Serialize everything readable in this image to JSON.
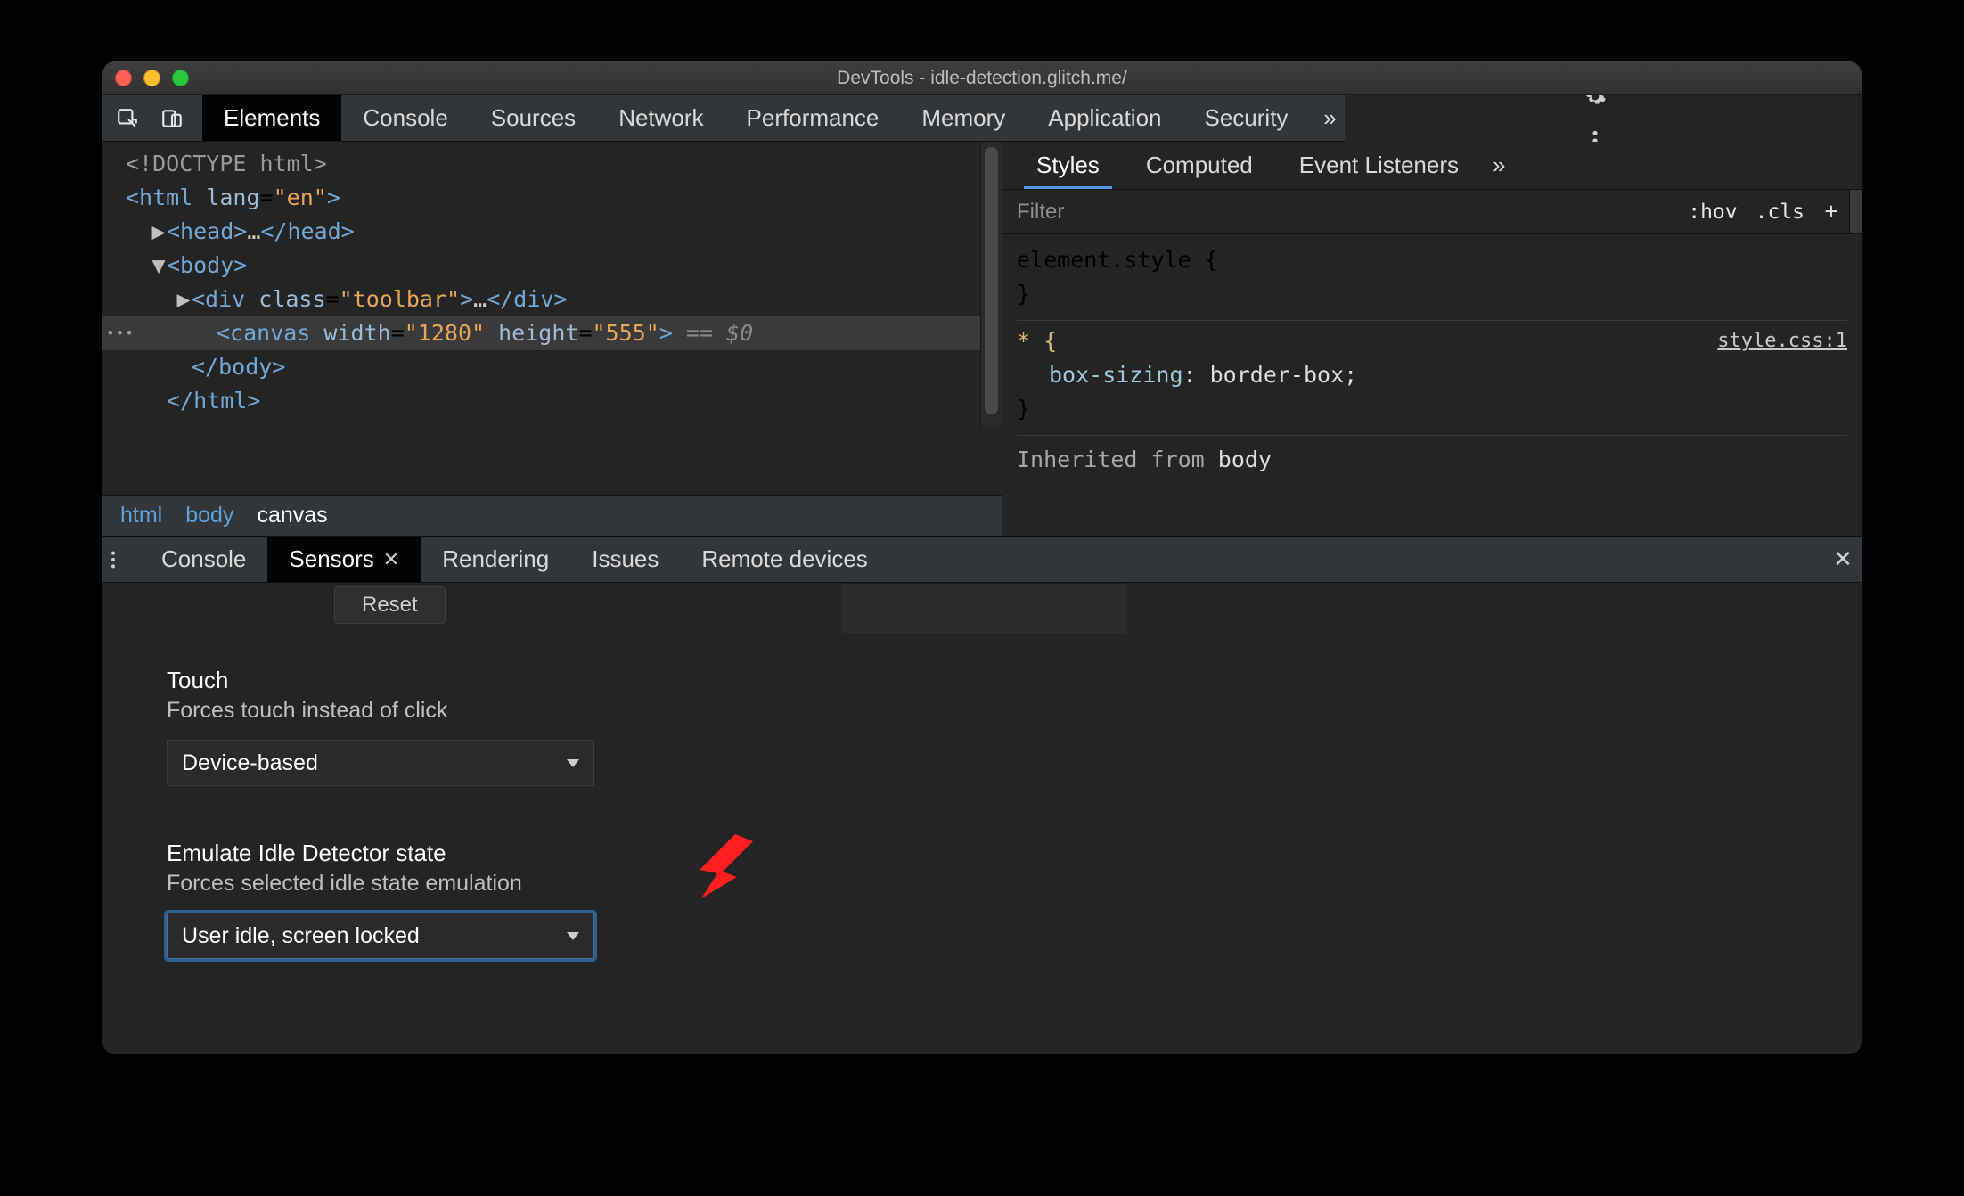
{
  "window": {
    "title": "DevTools - idle-detection.glitch.me/"
  },
  "tabs": {
    "items": [
      "Elements",
      "Console",
      "Sources",
      "Network",
      "Performance",
      "Memory",
      "Application",
      "Security"
    ],
    "active": "Elements"
  },
  "dom_tree": {
    "lines": [
      {
        "indent": 0,
        "html": "<span class='c-doctype'>&lt;!DOCTYPE html&gt;</span>",
        "selected": false
      },
      {
        "indent": 0,
        "html": "<span class='c-tag'>&lt;html</span> <span class='c-attr'>lang</span>=<span class='c-val'>\"en\"</span><span class='c-tag'>&gt;</span>",
        "selected": false
      },
      {
        "indent": 1,
        "caret": "▶",
        "html": "<span class='c-tag'>&lt;head&gt;</span><span class='c-text'>…</span><span class='c-tag'>&lt;/head&gt;</span>",
        "selected": false
      },
      {
        "indent": 1,
        "caret": "▼",
        "html": "<span class='c-tag'>&lt;body&gt;</span>",
        "selected": false
      },
      {
        "indent": 2,
        "caret": "▶",
        "html": "<span class='c-tag'>&lt;div</span> <span class='c-attr'>class</span>=<span class='c-val'>\"toolbar\"</span><span class='c-tag'>&gt;</span><span class='c-text'>…</span><span class='c-tag'>&lt;/div&gt;</span>",
        "selected": false
      },
      {
        "indent": 3,
        "html": "<span class='c-tag'>&lt;canvas</span> <span class='c-attr'>width</span>=<span class='c-val'>\"1280\"</span> <span class='c-attr'>height</span>=<span class='c-val'>\"555\"</span><span class='c-tag'>&gt;</span> <span class='c-dim'>== $0</span>",
        "selected": true
      },
      {
        "indent": 2,
        "html": "<span class='c-tag'>&lt;/body&gt;</span>",
        "selected": false
      },
      {
        "indent": 1,
        "html": "<span class='c-tag'>&lt;/html&gt;</span>",
        "selected": false
      }
    ]
  },
  "breadcrumbs": [
    "html",
    "body",
    "canvas"
  ],
  "styles_tabs": {
    "items": [
      "Styles",
      "Computed",
      "Event Listeners"
    ],
    "active": "Styles"
  },
  "styles_filter": {
    "placeholder": "Filter",
    "hov": ":hov",
    "cls": ".cls"
  },
  "styles_rules": {
    "element_style_open": "element.style {",
    "brace_close": "}",
    "star_sel": "* {",
    "star_src": "style.css:1",
    "star_prop": "box-sizing",
    "star_val": "border-box",
    "inherited_label": "Inherited from",
    "inherited_from": "body"
  },
  "drawer": {
    "tabs": [
      "Console",
      "Sensors",
      "Rendering",
      "Issues",
      "Remote devices"
    ],
    "active": "Sensors",
    "reset": "Reset",
    "touch": {
      "title": "Touch",
      "desc": "Forces touch instead of click",
      "value": "Device-based"
    },
    "idle": {
      "title": "Emulate Idle Detector state",
      "desc": "Forces selected idle state emulation",
      "value": "User idle, screen locked"
    }
  }
}
